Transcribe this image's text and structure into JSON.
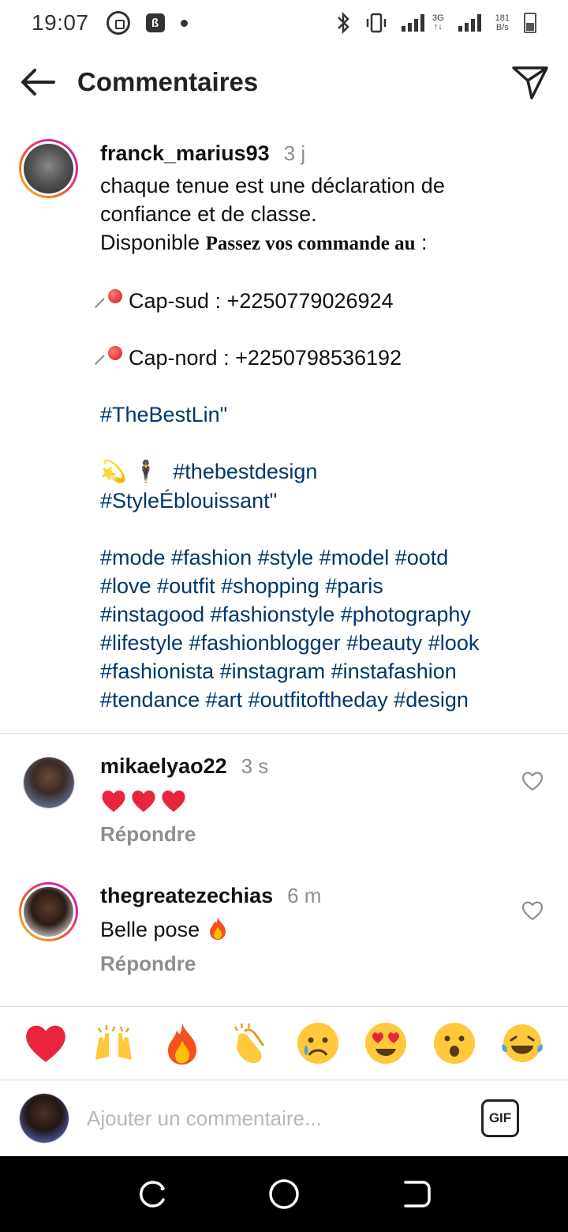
{
  "status_bar": {
    "time": "19:07",
    "network_type": "3G",
    "net_speed_value": "181",
    "net_speed_unit": "B/s"
  },
  "header": {
    "title": "Commentaires"
  },
  "caption": {
    "username": "franck_marius93",
    "time": "3 j",
    "line1": "chaque tenue est une déclaration de",
    "line2": "confiance et de classe.",
    "line3_prefix": "Disponible ",
    "line3_bold": "Passez vos commande au",
    "line3_suffix": " :",
    "cap_sud": "Cap-sud : +2250779026924",
    "cap_nord": "Cap-nord : +2250798536192",
    "hashtag_bestlin": "#TheBestLin\"",
    "emoji_sparkle": "💫",
    "emoji_man": "🕴",
    "hashtag_bestdesign": "#thebestdesign",
    "hashtag_style": "#StyleÉblouissant\"",
    "tags_line1": "#mode #fashion #style #model #ootd",
    "tags_line2": "#love #outfit #shopping #paris",
    "tags_line3": "#instagood #fashionstyle #photography",
    "tags_line4": "#lifestyle #fashionblogger #beauty #look",
    "tags_line5": "#fashionista #instagram #instafashion",
    "tags_line6": "#tendance #art #outfitoftheday #design"
  },
  "comments": [
    {
      "username": "mikaelyao22",
      "time": "3 s",
      "text_emoji": "❤️❤️❤️",
      "reply": "Répondre"
    },
    {
      "username": "thegreatezechias",
      "time": "6 m",
      "text": "Belle pose",
      "text_emoji": "🔥",
      "reply": "Répondre"
    }
  ],
  "quick_reactions": [
    "❤️",
    "🙌",
    "🔥",
    "👏",
    "😢",
    "😍",
    "😮",
    "😂"
  ],
  "composer": {
    "placeholder": "Ajouter un commentaire...",
    "gif_label": "GIF"
  },
  "colors": {
    "hashtag": "#00376b",
    "secondary_text": "#8e8e8e",
    "divider": "#dbdbdb"
  },
  "icons": {
    "back": "arrow-left-icon",
    "send": "paper-plane-icon",
    "like": "heart-outline-icon",
    "nav_recent": "recent-apps-icon",
    "nav_home": "home-circle-icon",
    "nav_back": "back-nav-icon"
  }
}
